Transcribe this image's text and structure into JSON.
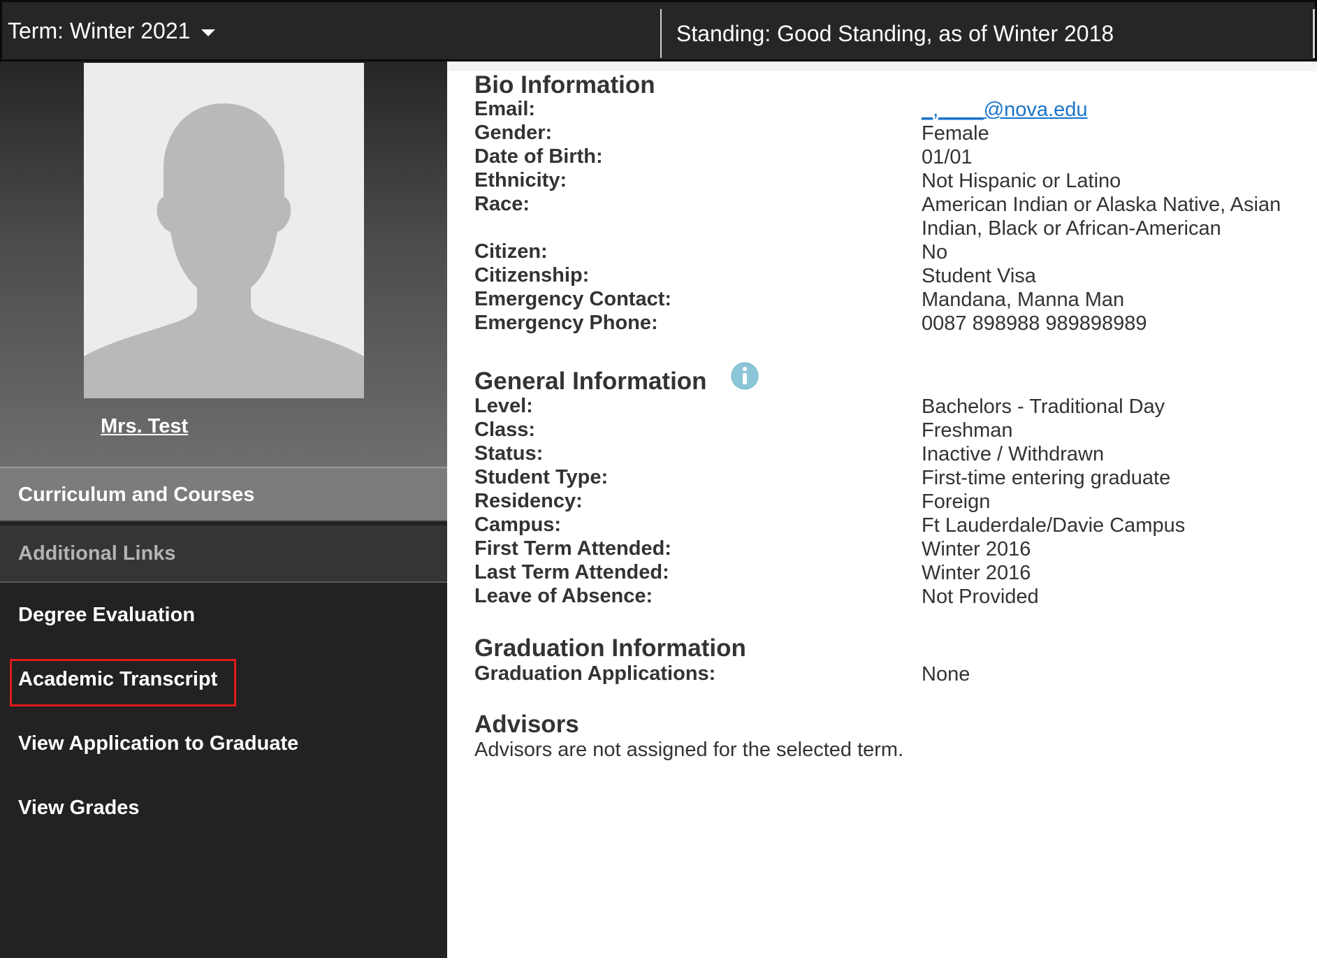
{
  "topbar": {
    "term_label": "Term: Winter 2021",
    "standing_label": "Standing: Good Standing, as of Winter 2018"
  },
  "sidebar": {
    "profile_name": "Mrs. Test",
    "curriculum_label": "Curriculum and Courses",
    "additional_links_label": "Additional Links",
    "links": [
      {
        "label": "Degree Evaluation"
      },
      {
        "label": "Academic Transcript"
      },
      {
        "label": "View Application to Graduate"
      },
      {
        "label": "View Grades"
      }
    ],
    "highlight_color": "#e11a1a"
  },
  "bio": {
    "title": "Bio Information",
    "rows": [
      {
        "label": "Email:",
        "value": "@nova.edu"
      },
      {
        "label": "Gender:",
        "value": "Female"
      },
      {
        "label": "Date of Birth:",
        "value": "01/01"
      },
      {
        "label": "Ethnicity:",
        "value": "Not Hispanic or Latino"
      },
      {
        "label": "Race:",
        "value": "American Indian or Alaska Native, Asian Indian, Black or African-American"
      },
      {
        "label": "Citizen:",
        "value": "No"
      },
      {
        "label": "Citizenship:",
        "value": "Student Visa"
      },
      {
        "label": "Emergency Contact:",
        "value": "Mandana, Manna Man"
      },
      {
        "label": "Emergency Phone:",
        "value": "0087 898988 989898989"
      }
    ]
  },
  "general": {
    "title": "General Information",
    "icon": "info-icon",
    "rows": [
      {
        "label": "Level:",
        "value": "Bachelors - Traditional Day"
      },
      {
        "label": "Class:",
        "value": "Freshman"
      },
      {
        "label": "Status:",
        "value": "Inactive / Withdrawn"
      },
      {
        "label": "Student Type:",
        "value": "First-time entering graduate"
      },
      {
        "label": "Residency:",
        "value": "Foreign"
      },
      {
        "label": "Campus:",
        "value": "Ft Lauderdale/Davie Campus"
      },
      {
        "label": "First Term Attended:",
        "value": "Winter 2016"
      },
      {
        "label": "Last Term Attended:",
        "value": "Winter 2016"
      },
      {
        "label": "Leave of Absence:",
        "value": "Not Provided"
      }
    ]
  },
  "graduation": {
    "title": "Graduation Information",
    "rows": [
      {
        "label": "Graduation Applications:",
        "value": "None"
      }
    ]
  },
  "advisors": {
    "title": "Advisors",
    "message": "Advisors are not assigned for the selected term."
  }
}
